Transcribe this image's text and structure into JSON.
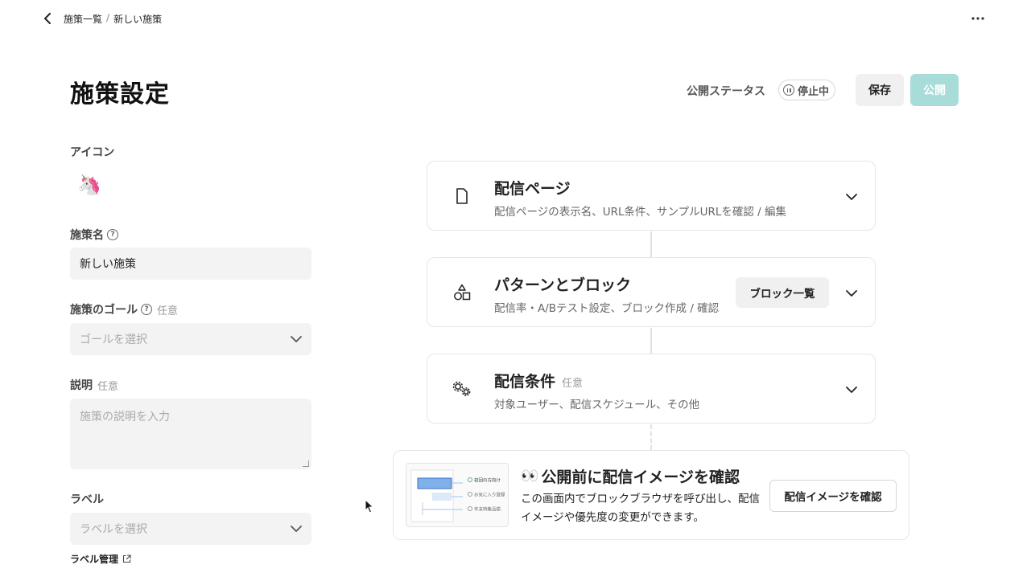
{
  "breadcrumb": {
    "parent": "施策一覧",
    "separator": "/",
    "current": "新しい施策"
  },
  "page": {
    "title": "施策設定"
  },
  "status": {
    "label": "公開ステータス",
    "value": "停止中"
  },
  "actions": {
    "save": "保存",
    "publish": "公開"
  },
  "form": {
    "icon": {
      "label": "アイコン",
      "value": "🦄"
    },
    "name": {
      "label": "施策名",
      "value": "新しい施策"
    },
    "goal": {
      "label": "施策のゴール",
      "optional": "任意",
      "placeholder": "ゴールを選択"
    },
    "description": {
      "label": "説明",
      "optional": "任意",
      "placeholder": "施策の説明を入力"
    },
    "labels": {
      "label": "ラベル",
      "placeholder": "ラベルを選択",
      "manage_link": "ラベル管理"
    }
  },
  "cards": [
    {
      "title": "配信ページ",
      "description": "配信ページの表示名、URL条件、サンプルURLを確認 / 編集",
      "icon": "page-icon"
    },
    {
      "title": "パターンとブロック",
      "description": "配信率・A/Bテスト設定、ブロック作成 / 確認",
      "button": "ブロック一覧",
      "icon": "shapes-icon"
    },
    {
      "title": "配信条件",
      "optional": "任意",
      "description": "対象ユーザー、配信スケジュール、その他",
      "icon": "gears-icon"
    }
  ],
  "preview": {
    "emoji": "👀",
    "title": "公開前に配信イメージを確認",
    "description": "この画面内でブロックブラウザを呼び出し、配信イメージや優先度の変更ができます。",
    "button": "配信イメージを確認",
    "thumb_items": [
      "初回の方向け",
      "お気に入り登録",
      "年末特集品揃"
    ]
  },
  "colors": {
    "accent": "#a8dcd9",
    "thumb_highlight": "#7fb0ea"
  }
}
